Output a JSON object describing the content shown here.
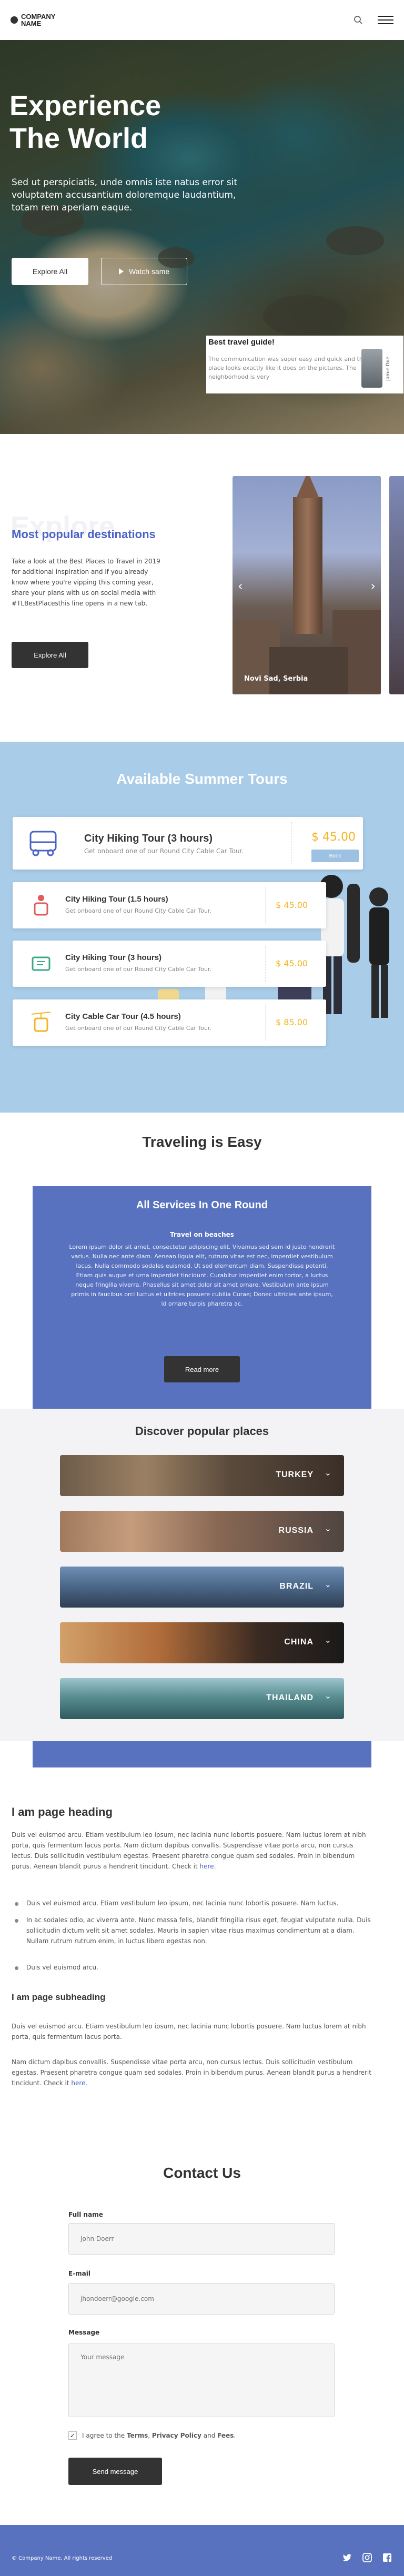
{
  "header": {
    "logo_text_line1": "COMPANY",
    "logo_text_line2": "NAME"
  },
  "hero": {
    "title_line1": "Experience",
    "title_line2": "The World",
    "subtitle": "Sed ut perspiciatis, unde omnis iste natus error sit voluptatem accusantium doloremque laudantium, totam rem aperiam eaque.",
    "explore_label": "Explore All",
    "watch_label": "Watch same",
    "guide": {
      "title": "Best travel guide!",
      "text": "The communication was super easy and quick and the place looks exactly like it does on the pictures. The neighborhood is very",
      "name": "Jamie Doe"
    }
  },
  "destinations": {
    "bg_word": "Explore",
    "title": "Most popular destinations",
    "text": "Take a look at the Best Places to Travel in 2019 for additional inspiration and if you already know where you're vipping this coming year, share your plans with us on social media with #TLBestPlacesthis line opens in a new tab.",
    "button": "Explore All",
    "slide_caption": "Novi Sad, Serbia"
  },
  "tours": {
    "title": "Available Summer Tours",
    "items": [
      {
        "name": "City Hiking Tour (3 hours)",
        "desc": "Get onboard one of our Round City Cable Car Tour.",
        "price": "$ 45.00",
        "book": "Book"
      },
      {
        "name": "City Hiking Tour (1.5 hours)",
        "desc": "Get onboard one of our Round City Cable Car Tour.",
        "price": "$ 45.00"
      },
      {
        "name": "City Hiking Tour (3 hours)",
        "desc": "Get onboard one of our Round City Cable Car Tour.",
        "price": "$ 45.00"
      },
      {
        "name": "City Cable Car Tour (4.5 hours)",
        "desc": "Get onboard one of our Round City Cable Car Tour.",
        "price": "$ 85.00"
      }
    ]
  },
  "traveling": {
    "title": "Traveling is Easy",
    "services_title": "All Services In One Round",
    "services_sub": "Travel on beaches",
    "services_text": "Lorem ipsum dolor sit amet, consectetur adipiscing elit. Vivamus sed sem id justo hendrerit varius. Nulla nec ante diam. Aenean ligula elit, rutrum vitae est nec, imperdiet vestibulum lacus. Nulla commodo sodales euismod. Ut sed elementum diam. Suspendisse potenti. Etiam quis augue et urna imperdiet tincidunt. Curabitur imperdiet enim tortor, a luctus neque fringilla viverra. Phasellus sit amet dolor sit amet ornare. Vestibulum ante ipsum primis in faucibus orci luctus et ultrices posuere cubilia Curae; Donec ultricies ante ipsum, id ornare turpis pharetra ac.",
    "read_more": "Read more",
    "places_title": "Discover popular places",
    "places": [
      "TURKEY",
      "RUSSIA",
      "BRAZIL",
      "CHINA",
      "THAILAND"
    ]
  },
  "article": {
    "heading": "I am page heading",
    "p1": "Duis vel euismod arcu. Etiam vestibulum leo ipsum, nec lacinia nunc lobortis posuere. Nam luctus lorem at nibh porta, quis fermentum lacus porta. Nam dictum dapibus convallis. Suspendisse vitae porta arcu, non cursus lectus. Duis sollicitudin vestibulum egestas. Praesent pharetra congue quam sed sodales. Proin in bibendum purus. Aenean blandit purus a hendrerit tincidunt. Check it",
    "p1_link": "here.",
    "li1": "Duis vel euismod arcu. Etiam vestibulum leo ipsum, nec lacinia nunc lobortis posuere. Nam luctus.",
    "li2": "In ac sodales odio, ac viverra ante. Nunc massa felis, blandit fringilla risus eget, feugiat vulputate nulla. Duis sollicitudin dictum velit sit amet sodales. Mauris in sapien vitae risus maximus condimentum at a diam. Nullam rutrum rutrum enim, in luctus libero egestas non.",
    "li3": "Duis vel euismod arcu.",
    "subheading": "I am page subheading",
    "p2": "Duis vel euismod arcu. Etiam vestibulum leo ipsum, nec lacinia nunc lobortis posuere. Nam luctus lorem at nibh porta, quis fermentum lacus porta.",
    "p3": "Nam dictum dapibus convallis. Suspendisse vitae porta arcu, non cursus lectus. Duis sollicitudin vestibulum egestas. Praesent pharetra congue quam sed sodales. Proin in bibendum purus. Aenean blandit purus a hendrerit tincidunt. Check it",
    "p3_link": "here."
  },
  "contact": {
    "title": "Contact Us",
    "name_label": "Full name",
    "name_placeholder": "John Doerr",
    "email_label": "E-mail",
    "email_placeholder": "jhondoerr@google.com",
    "message_label": "Message",
    "message_placeholder": "Your message",
    "agree_prefix": "I agree to the",
    "terms": "Terms",
    "privacy": "Privacy Policy",
    "and": "and",
    "fees": "Fees",
    "send": "Send message"
  },
  "footer": {
    "copyright": "© Company Name. All rights reserved"
  },
  "colors": {
    "accent": "#5872bf",
    "tour_bg": "#a9cde9",
    "price": "#f3b520"
  }
}
